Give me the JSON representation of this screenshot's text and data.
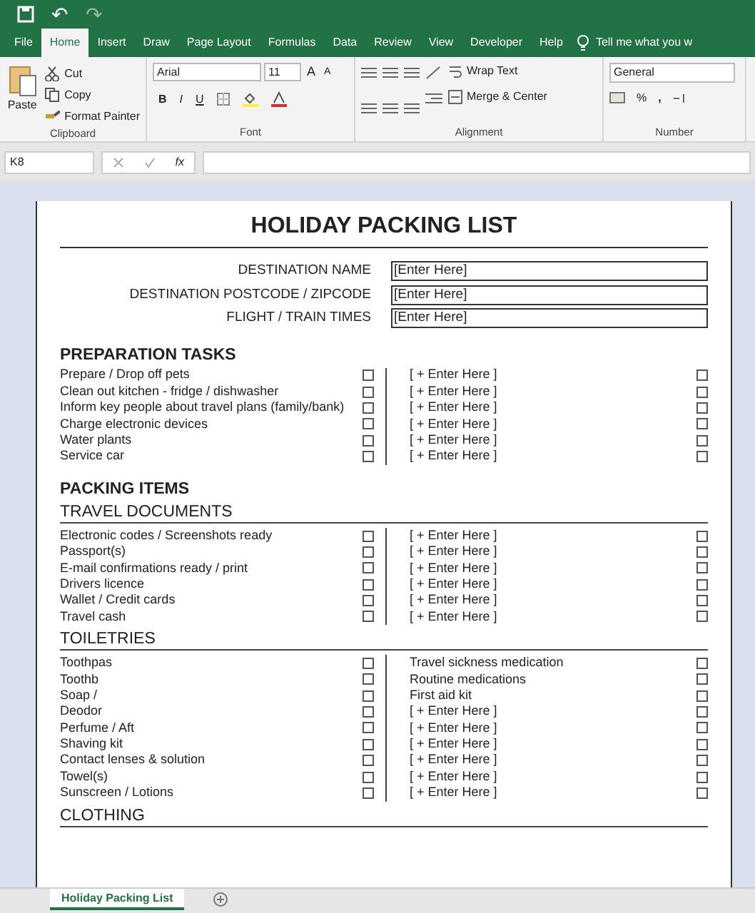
{
  "quick_access": {
    "undo": "↶",
    "redo": "↷"
  },
  "tabs": [
    {
      "label": "File",
      "selected": false
    },
    {
      "label": "Home",
      "selected": true
    },
    {
      "label": "Insert",
      "selected": false
    },
    {
      "label": "Draw",
      "selected": false
    },
    {
      "label": "Page Layout",
      "selected": false
    },
    {
      "label": "Formulas",
      "selected": false
    },
    {
      "label": "Data",
      "selected": false
    },
    {
      "label": "Review",
      "selected": false
    },
    {
      "label": "View",
      "selected": false
    },
    {
      "label": "Developer",
      "selected": false
    },
    {
      "label": "Help",
      "selected": false
    }
  ],
  "tell_me": "Tell me what you w",
  "ribbon": {
    "clipboard": {
      "paste": "Paste",
      "cut": "Cut",
      "copy": "Copy",
      "format_painter": "Format Painter",
      "label": "Clipboard"
    },
    "font": {
      "name": "Arial",
      "size": "11",
      "grow": "A",
      "shrink": "A",
      "bold": "B",
      "italic": "I",
      "underline": "U",
      "label": "Font"
    },
    "alignment": {
      "wrap": "Wrap Text",
      "merge": "Merge & Center",
      "label": "Alignment"
    },
    "number": {
      "format": "General",
      "percent": "%",
      "comma": ",",
      "label": "Number"
    }
  },
  "formula_bar": {
    "name_box": "K8",
    "fx": "fx"
  },
  "document": {
    "title": "HOLIDAY PACKING LIST",
    "fields": [
      {
        "label": "DESTINATION NAME",
        "value": "[Enter Here]"
      },
      {
        "label": "DESTINATION POSTCODE / ZIPCODE",
        "value": "[Enter Here]"
      },
      {
        "label": "FLIGHT / TRAIN TIMES",
        "value": "[Enter Here]"
      }
    ],
    "blocks": [
      {
        "kind": "heading",
        "text": "PREPARATION TASKS",
        "items": [
          {
            "left": "Prepare / Drop off pets",
            "left_checked": false,
            "right": "[ + Enter Here ]",
            "right_checked": false
          },
          {
            "left": "Clean out kitchen - fridge / dishwasher",
            "left_checked": false,
            "right": "[ + Enter Here ]",
            "right_checked": false
          },
          {
            "left": "Inform key people about travel plans (family/bank)",
            "left_checked": false,
            "right": "[ + Enter Here ]",
            "right_checked": false
          },
          {
            "left": "Charge electronic devices",
            "left_checked": false,
            "right": "[ + Enter Here ]",
            "right_checked": false
          },
          {
            "left": "Water plants",
            "left_checked": false,
            "right": "[ + Enter Here ]",
            "right_checked": false
          },
          {
            "left": "Service car",
            "left_checked": false,
            "right": "[ + Enter Here ]",
            "right_checked": false
          }
        ]
      },
      {
        "kind": "heading",
        "text": "PACKING ITEMS"
      },
      {
        "kind": "subheading",
        "text": "TRAVEL DOCUMENTS",
        "items": [
          {
            "left": "Electronic codes / Screenshots ready",
            "left_checked": false,
            "right": "[ + Enter Here ]",
            "right_checked": false
          },
          {
            "left": "Passport(s)",
            "left_checked": false,
            "right": "[ + Enter Here ]",
            "right_checked": false
          },
          {
            "left": "E-mail confirmations ready / print",
            "left_checked": false,
            "right": "[ + Enter Here ]",
            "right_checked": false
          },
          {
            "left": "Drivers licence",
            "left_checked": false,
            "right": "[ + Enter Here ]",
            "right_checked": false
          },
          {
            "left": "Wallet / Credit cards",
            "left_checked": false,
            "right": "[ + Enter Here ]",
            "right_checked": false
          },
          {
            "left": "Travel cash",
            "left_checked": false,
            "right": "[ + Enter Here ]",
            "right_checked": false
          }
        ]
      },
      {
        "kind": "subheading",
        "text": "TOILETRIES",
        "items": [
          {
            "left": "Toothpas",
            "left_checked": false,
            "right": "Travel sickness medication",
            "right_checked": false
          },
          {
            "left": "Toothb",
            "left_checked": false,
            "right": "Routine medications",
            "right_checked": false
          },
          {
            "left": "Soap /",
            "left_checked": false,
            "right": "First aid kit",
            "right_checked": false
          },
          {
            "left": "Deodor",
            "left_checked": false,
            "right": "[ + Enter Here ]",
            "right_checked": false
          },
          {
            "left": "Perfume / Aft",
            "left_checked": false,
            "right": "[ + Enter Here ]",
            "right_checked": false
          },
          {
            "left": "Shaving kit",
            "left_checked": false,
            "right": "[ + Enter Here ]",
            "right_checked": false
          },
          {
            "left": "Contact lenses & solution",
            "left_checked": false,
            "right": "[ + Enter Here ]",
            "right_checked": false
          },
          {
            "left": "Towel(s)",
            "left_checked": false,
            "right": "[ + Enter Here ]",
            "right_checked": false
          },
          {
            "left": "Sunscreen / Lotions",
            "left_checked": false,
            "right": "[ + Enter Here ]",
            "right_checked": false
          }
        ]
      },
      {
        "kind": "subheading",
        "text": "CLOTHING"
      }
    ]
  },
  "sheet_tabs": [
    {
      "label": "Holiday Packing List",
      "selected": true
    }
  ]
}
